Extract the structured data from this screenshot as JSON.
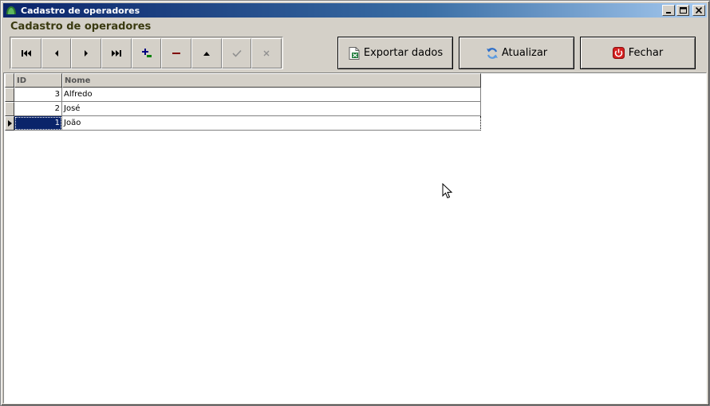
{
  "window": {
    "title": "Cadastro de operadores"
  },
  "form": {
    "heading": "Cadastro de operadores"
  },
  "navigator": {
    "buttons": [
      {
        "name": "first",
        "icon": "skip-first-icon"
      },
      {
        "name": "prior",
        "icon": "prev-icon"
      },
      {
        "name": "next",
        "icon": "next-icon"
      },
      {
        "name": "last",
        "icon": "skip-last-icon"
      },
      {
        "name": "insert",
        "icon": "plus-icon"
      },
      {
        "name": "delete",
        "icon": "minus-icon"
      },
      {
        "name": "edit",
        "icon": "up-triangle-icon"
      },
      {
        "name": "post",
        "icon": "check-icon"
      },
      {
        "name": "cancel",
        "icon": "x-icon"
      }
    ]
  },
  "actions": {
    "export_label": "Exportar dados",
    "refresh_label": "Atualizar",
    "close_label": "Fechar"
  },
  "grid": {
    "columns": [
      "ID",
      "Nome"
    ],
    "rows": [
      {
        "id": "3",
        "nome": "Alfredo"
      },
      {
        "id": "2",
        "nome": "José"
      },
      {
        "id": "1",
        "nome": "João"
      }
    ],
    "selected_row": 2
  },
  "colors": {
    "title_gradient_start": "#0a246a",
    "title_gradient_end": "#a6caf0",
    "selection": "#0a246a",
    "face": "#d4d0c8"
  }
}
